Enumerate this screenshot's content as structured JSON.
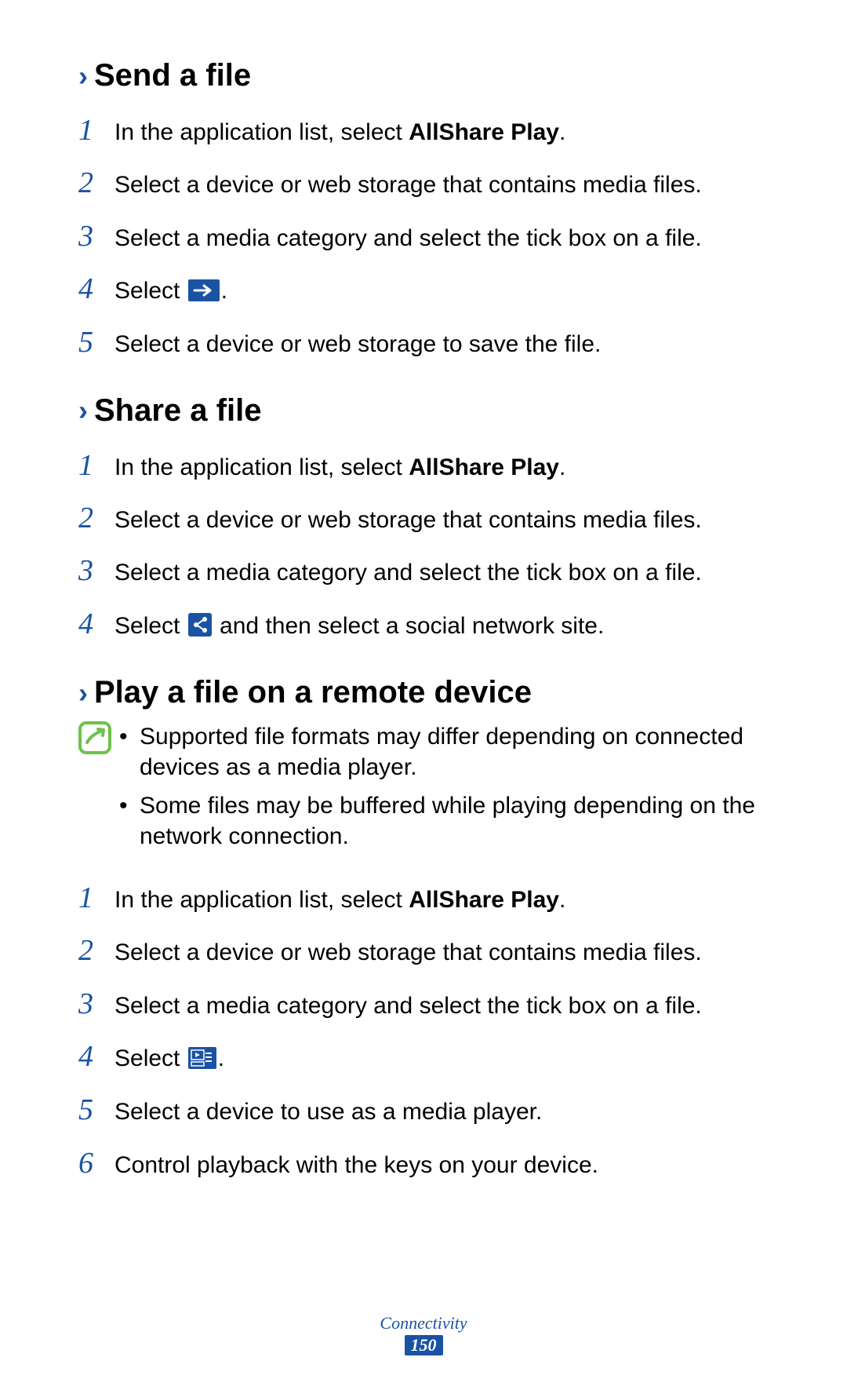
{
  "footer": {
    "category": "Connectivity",
    "page": "150"
  },
  "sections": [
    {
      "title": "Send a file",
      "steps": [
        {
          "pre": "In the application list, select ",
          "bold": "AllShare Play",
          "post": "."
        },
        {
          "pre": "Select a device or web storage that contains media files."
        },
        {
          "pre": "Select a media category and select the tick box on a file."
        },
        {
          "pre": "Select ",
          "icon": "send-arrow",
          "post": "."
        },
        {
          "pre": "Select a device or web storage to save the file."
        }
      ]
    },
    {
      "title": "Share a file",
      "steps": [
        {
          "pre": "In the application list, select ",
          "bold": "AllShare Play",
          "post": "."
        },
        {
          "pre": "Select a device or web storage that contains media files."
        },
        {
          "pre": "Select a media category and select the tick box on a file."
        },
        {
          "pre": "Select ",
          "icon": "share",
          "post": " and then select a social network site."
        }
      ]
    },
    {
      "title": "Play a file on a remote device",
      "notes": [
        "Supported file formats may differ depending on connected devices as a media player.",
        "Some files may be buffered while playing depending on the network connection."
      ],
      "steps": [
        {
          "pre": "In the application list, select ",
          "bold": "AllShare Play",
          "post": "."
        },
        {
          "pre": "Select a device or web storage that contains media files."
        },
        {
          "pre": "Select a media category and select the tick box on a file."
        },
        {
          "pre": "Select ",
          "icon": "remote-play",
          "post": "."
        },
        {
          "pre": "Select a device to use as a media player."
        },
        {
          "pre": "Control playback with the keys on your device."
        }
      ]
    }
  ],
  "nums": [
    "1",
    "2",
    "3",
    "4",
    "5",
    "6"
  ]
}
